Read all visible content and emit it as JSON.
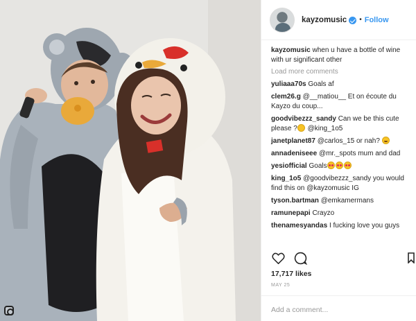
{
  "post": {
    "username": "kayzomusic",
    "follow_label": "Follow",
    "separator": "•"
  },
  "caption": {
    "username": "kayzomusic",
    "text": "when u have a bottle of wine with ur significant other"
  },
  "load_more_label": "Load more comments",
  "comments": [
    {
      "user": "yuliaaa70s",
      "text": "Goals af"
    },
    {
      "user": "clem26.g",
      "text": "@__matiou__ Et on écoute du Kayzo du coup..."
    },
    {
      "user": "goodvibezzz_sandy",
      "text": "Can we be this cute please ?",
      "after": " @king_1o5"
    },
    {
      "user": "janetplanet87",
      "text": "@carlos_15 or nah?"
    },
    {
      "user": "annadeniseee",
      "text": "@mr._spots mum and dad"
    },
    {
      "user": "yesiofficial",
      "text": "Goals"
    },
    {
      "user": "king_1o5",
      "text": "@goodvibezzz_sandy you would find this on @kayzomusic IG"
    },
    {
      "user": "tyson.bartman",
      "text": "@emkamermans"
    },
    {
      "user": "ramunepapi",
      "text": "Crayzo"
    },
    {
      "user": "thenamesyandas",
      "text": "I fucking love you guys"
    }
  ],
  "likes": "17,717 likes",
  "date": "MAY 25",
  "add_comment_placeholder": "Add a comment...",
  "colors": {
    "accent": "#3897f0",
    "text": "#262626",
    "muted": "#999999"
  },
  "icons": [
    "verified-badge-icon",
    "heart-icon",
    "comment-icon",
    "bookmark-icon",
    "instagram-icon"
  ]
}
